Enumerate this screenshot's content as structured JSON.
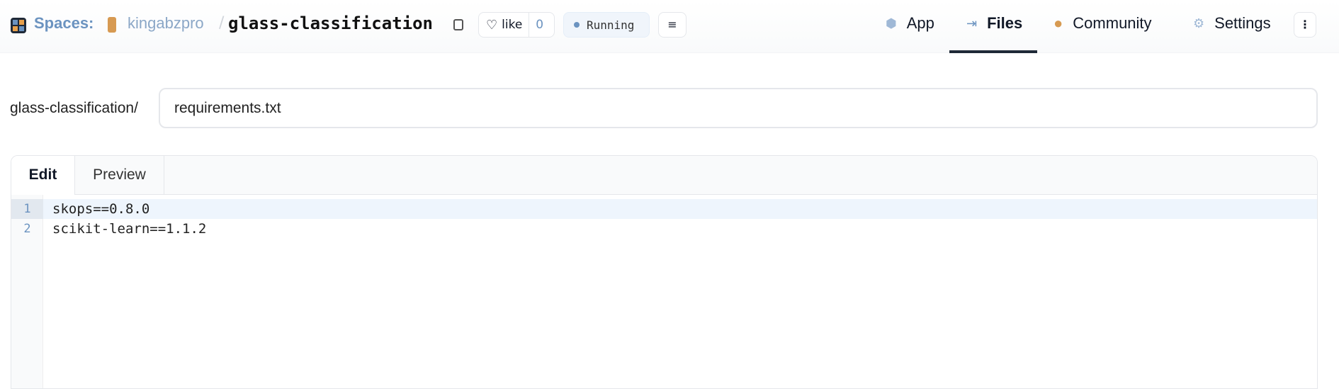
{
  "header": {
    "spaces_label": "Spaces:",
    "owner": "kingabzpro",
    "separator": "/",
    "repo": "glass-classification",
    "like_label": "like",
    "like_count": "0",
    "status": "Running",
    "nav": [
      {
        "label": "App",
        "icon": "app-cube-icon"
      },
      {
        "label": "Files",
        "icon": "files-icon",
        "active": true
      },
      {
        "label": "Community",
        "icon": "community-icon"
      },
      {
        "label": "Settings",
        "icon": "gear-icon"
      }
    ],
    "accent": "#6b93c0"
  },
  "path": {
    "prefix": "glass-classification/",
    "filename": "requirements.txt"
  },
  "editor": {
    "tabs": [
      {
        "label": "Edit",
        "active": true
      },
      {
        "label": "Preview"
      }
    ],
    "lines": [
      {
        "num": "1",
        "text": "skops==0.8.0"
      },
      {
        "num": "2",
        "text": "scikit-learn==1.1.2"
      }
    ]
  }
}
